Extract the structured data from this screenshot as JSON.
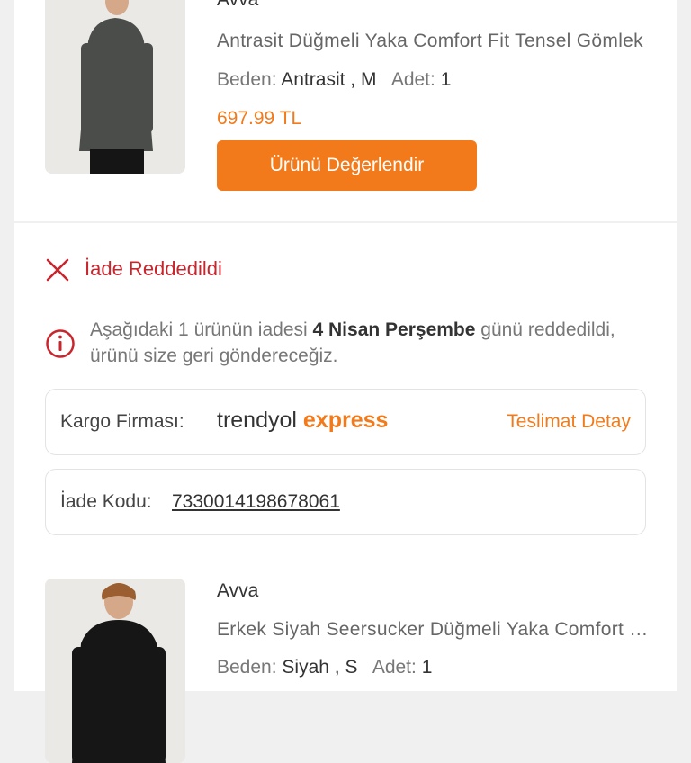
{
  "products": [
    {
      "brand": "Avva",
      "title": "Antrasit Düğmeli Yaka Comfort Fit Tensel Gömlek",
      "size_label": "Beden:",
      "size_value": "Antrasit , M",
      "qty_label": "Adet:",
      "qty_value": "1",
      "price": "697.99 TL",
      "review_button": "Ürünü Değerlendir",
      "shirt_color": "#4a4d4a"
    },
    {
      "brand": "Avva",
      "title": "Erkek Siyah Seersucker Düğmeli Yaka Comfort Fit Gömlek",
      "size_label": "Beden:",
      "size_value": "Siyah , S",
      "qty_label": "Adet:",
      "qty_value": "1",
      "shirt_color": "#161616"
    }
  ],
  "return_status": {
    "status": "İade Reddedildi",
    "info_pre": "Aşağıdaki 1 ürünün iadesi ",
    "info_bold": "4 Nisan Perşembe",
    "info_post": " günü reddedildi, ürünü size geri göndereceğiz."
  },
  "shipping": {
    "label": "Kargo Firması:",
    "logo_part1": "trendyol",
    "logo_part2": "express",
    "detail_link": "Teslimat Detay"
  },
  "return_code": {
    "label": "İade Kodu:",
    "value": "7330014198678061"
  },
  "colors": {
    "accent": "#f27a1a",
    "error": "#c9252d"
  }
}
